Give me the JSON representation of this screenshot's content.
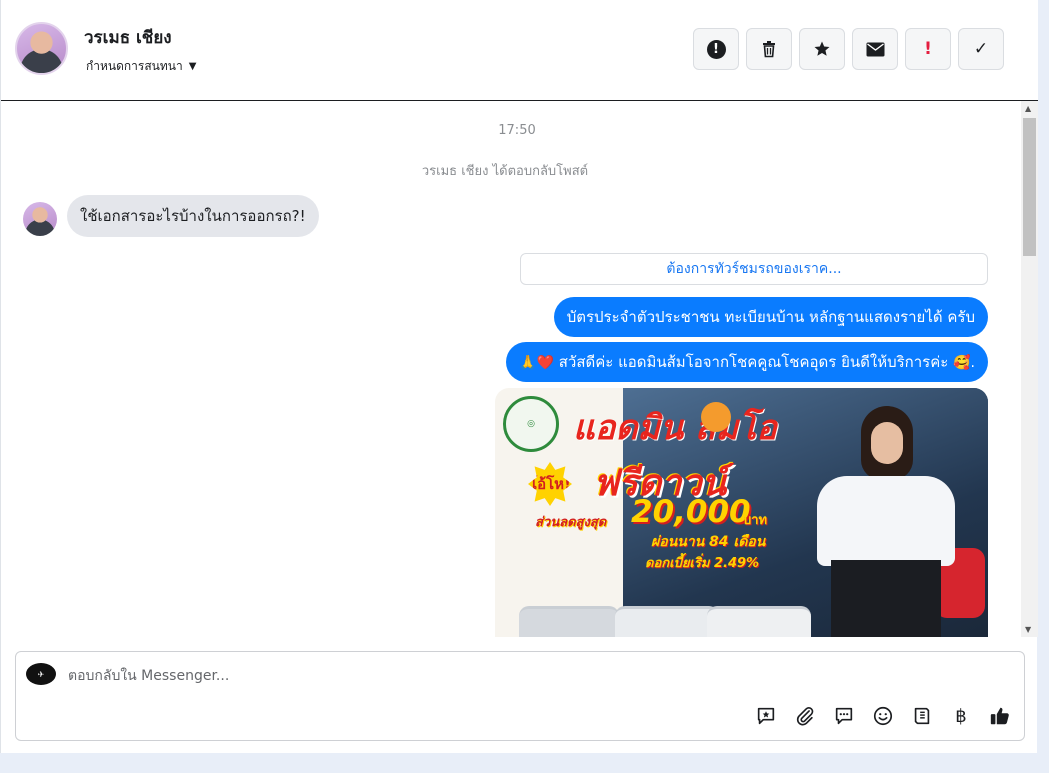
{
  "header": {
    "contact_name": "วรเมธ เชียง",
    "conversation_settings": "กำหนดการสนทนา",
    "toolbar": [
      {
        "name": "report-spam-button",
        "icon": "alert-circle-icon"
      },
      {
        "name": "delete-button",
        "icon": "trash-icon"
      },
      {
        "name": "star-button",
        "icon": "star-icon"
      },
      {
        "name": "mark-unread-button",
        "icon": "envelope-icon"
      },
      {
        "name": "mark-important-button",
        "icon": "exclamation-icon",
        "glyph": "!"
      },
      {
        "name": "mark-done-button",
        "icon": "check-icon",
        "glyph": "✓"
      }
    ]
  },
  "chat": {
    "timestamp": "17:50",
    "reply_notice": "วรเมธ เชียง ได้ตอบกลับโพสต์",
    "incoming_message": "ใช้เอกสารอะไรบ้างในการออกรถ?!",
    "quick_reply": "ต้องการทัวร์ชมรถของเราค...",
    "outgoing_messages": [
      "บัตรประจำตัวประชาชน ทะเบียนบ้าน หลักฐานแสดงรายได้ ครับ",
      "สวัสดีค่ะ แอดมินส้มโอจากโชคคูณโชคอุดร ยินดีให้บริการค่ะ"
    ],
    "outgoing_emoji_prefix": "🙏❤️",
    "outgoing_emoji_suffix": "🥰.",
    "promo_image": {
      "brand_title": "แอดมิน ส้มโอ",
      "badge": "โอ้โห!",
      "headline": "ฟรีดาวน์",
      "discount_label": "ส่วนลดสูงสุด",
      "discount_amount": "20,000",
      "currency": "บาท",
      "installment": "ผ่อนนาน 84 เดือน",
      "interest": "ดอกเบี้ยเริ่ม 2.49%"
    }
  },
  "composer": {
    "placeholder": "ตอบกลับใน Messenger...",
    "tools": [
      "saved-reply-icon",
      "attachment-icon",
      "chat-bubble-icon",
      "emoji-icon",
      "catalog-icon",
      "baht-icon",
      "like-icon"
    ],
    "baht_glyph": "฿"
  },
  "colors": {
    "accent": "#0a7cff",
    "link": "#1877f2",
    "danger": "#e41e3f",
    "bubble_in": "#e4e6eb"
  }
}
